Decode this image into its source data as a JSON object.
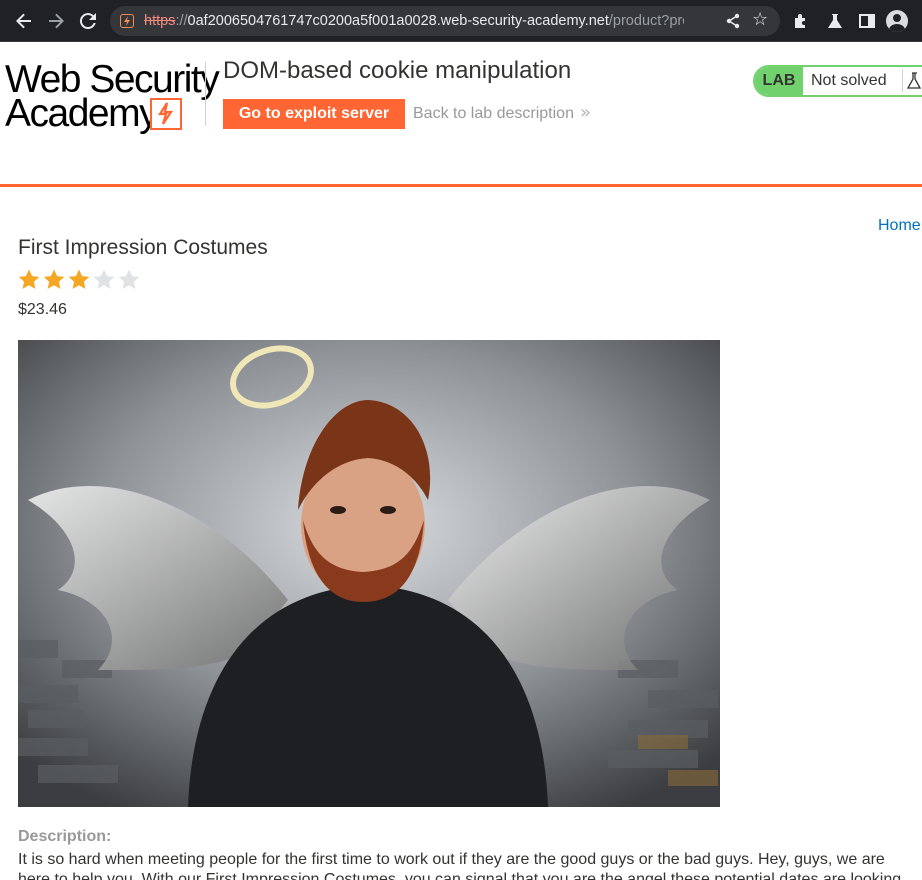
{
  "browser": {
    "url_scheme": "https",
    "url_sep": "://",
    "url_host": "0af2006504761747c0200a5f001a0028.web-security-academy.net",
    "url_path": "/product?prod..."
  },
  "header": {
    "logo_line1": "Web Security",
    "logo_line2": "Academy",
    "lab_title": "DOM-based cookie manipulation",
    "exploit_button": "Go to exploit server",
    "back_link": "Back to lab description",
    "lab_badge": "LAB",
    "lab_status": "Not solved",
    "accent_color": "#ff6633",
    "status_color": "#70d16d"
  },
  "nav": {
    "home": "Home"
  },
  "product": {
    "title": "First Impression Costumes",
    "rating": 3,
    "rating_max": 5,
    "price": "$23.46",
    "description_label": "Description:",
    "description": "It is so hard when meeting people for the first time to work out if they are the good guys or the bad guys. Hey, guys, we are here to help you. With our First Impression Costumes, you can signal that you are the angel these potential dates are looking"
  }
}
